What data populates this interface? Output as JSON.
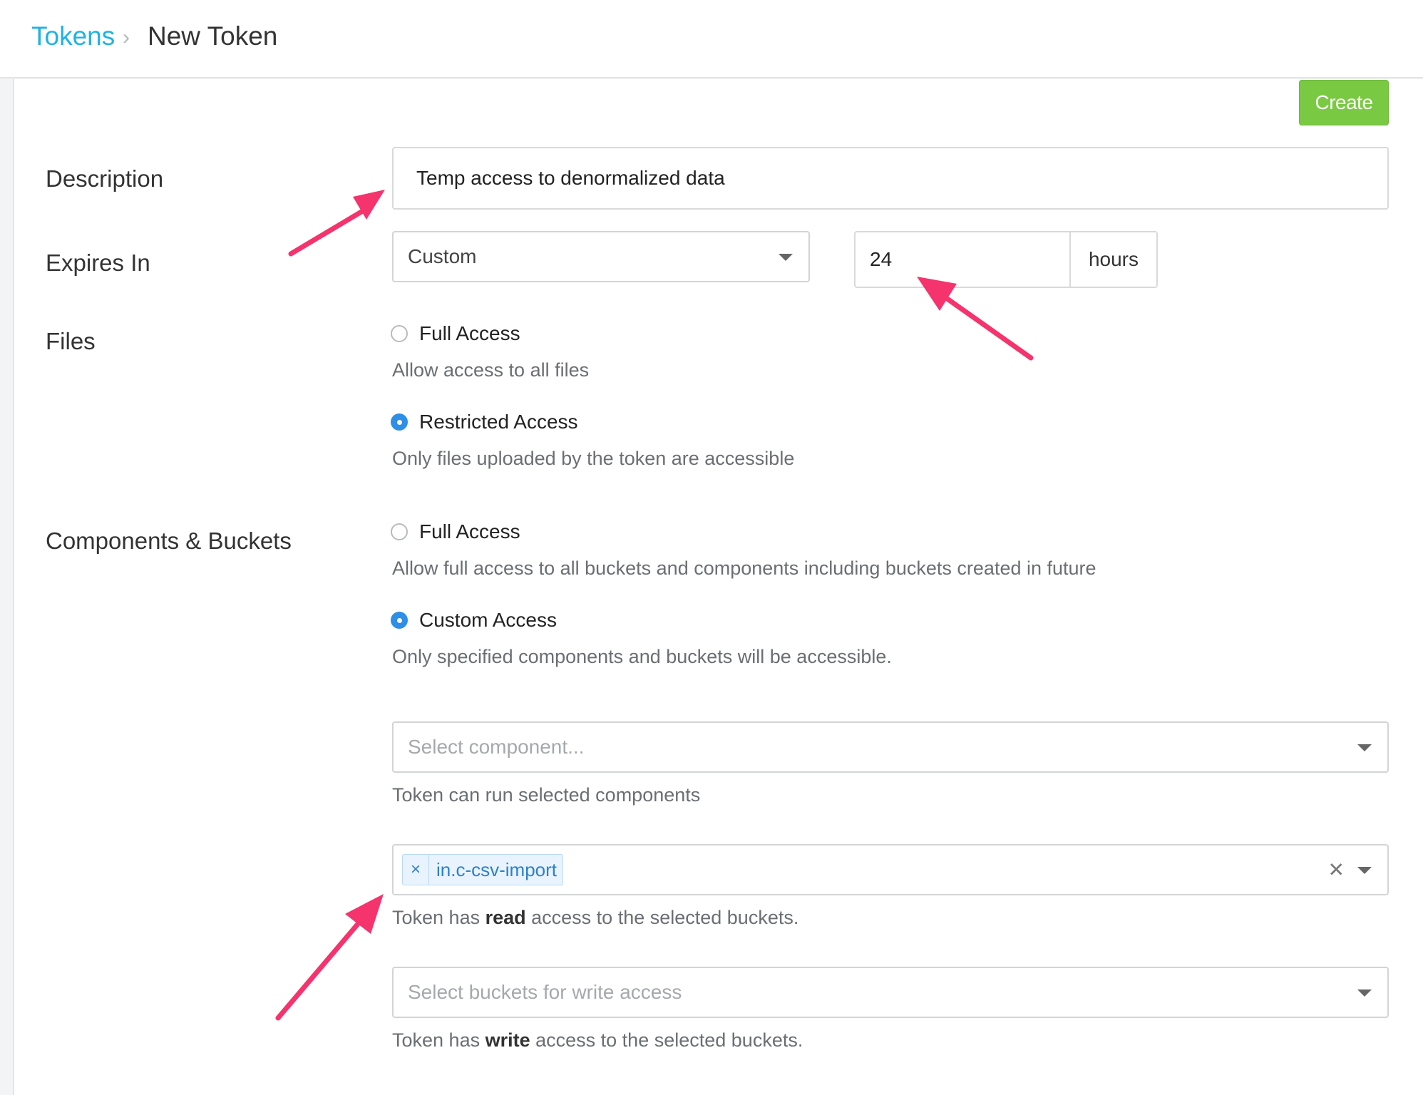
{
  "breadcrumb": {
    "parent": "Tokens",
    "separator": "›",
    "current": "New Token"
  },
  "actions": {
    "create_label": "Create"
  },
  "form": {
    "description": {
      "label": "Description",
      "value": "Temp access to denormalized data"
    },
    "expires": {
      "label": "Expires In",
      "select_value": "Custom",
      "amount": "24",
      "unit": "hours"
    },
    "files": {
      "label": "Files",
      "options": [
        {
          "label": "Full Access",
          "help": "Allow access to all files",
          "checked": false
        },
        {
          "label": "Restricted Access",
          "help": "Only files uploaded by the token are accessible",
          "checked": true
        }
      ]
    },
    "components": {
      "label": "Components & Buckets",
      "options": [
        {
          "label": "Full Access",
          "help": "Allow full access to all buckets and components including buckets created in future",
          "checked": false
        },
        {
          "label": "Custom Access",
          "help": "Only specified components and buckets will be accessible.",
          "checked": true
        }
      ],
      "component_select": {
        "placeholder": "Select component...",
        "help": "Token can run selected components"
      },
      "read_buckets": {
        "tags": [
          "in.c-csv-import"
        ],
        "help_prefix": "Token has ",
        "help_bold": "read",
        "help_suffix": " access to the selected buckets."
      },
      "write_buckets": {
        "placeholder": "Select buckets for write access",
        "help_prefix": "Token has ",
        "help_bold": "write",
        "help_suffix": " access to the selected buckets."
      }
    }
  },
  "colors": {
    "accent": "#1fb3e4",
    "create": "#7ac943",
    "radio_checked": "#2d8fe6",
    "annotation_arrow": "#f5336d"
  }
}
